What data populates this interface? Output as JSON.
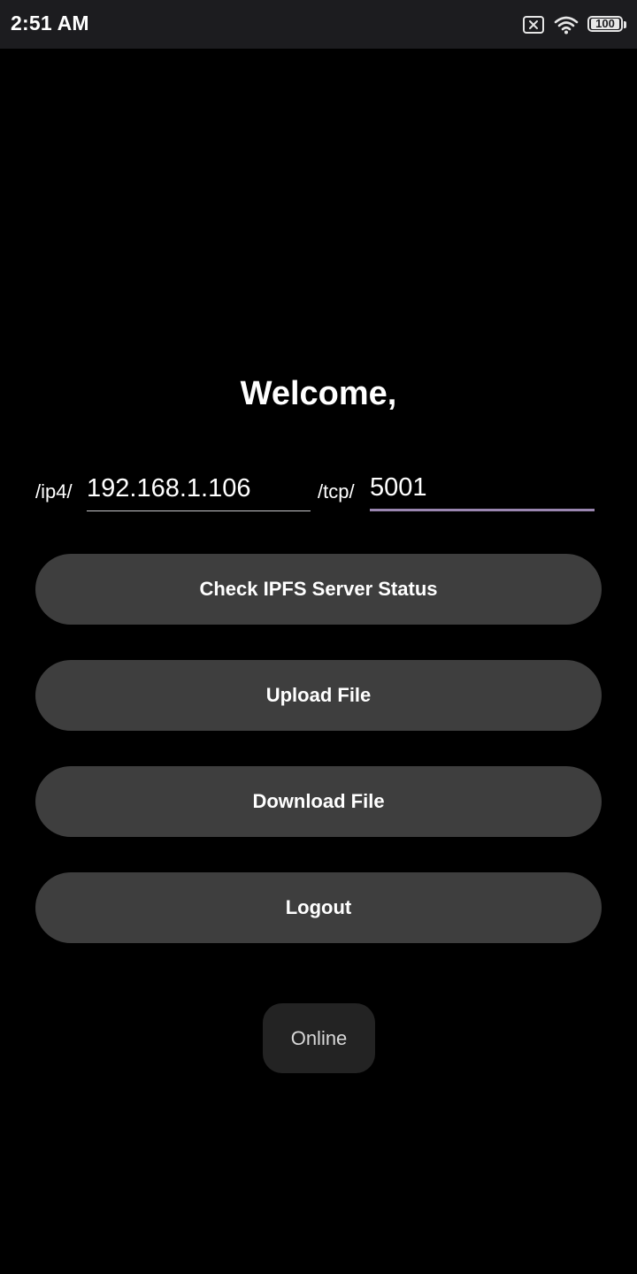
{
  "status_bar": {
    "time": "2:51 AM",
    "battery": "100",
    "icons": [
      "sim-missing-icon",
      "wifi-icon",
      "battery-icon"
    ]
  },
  "main": {
    "welcome": "Welcome,",
    "ip_prefix": "/ip4/",
    "ip_value": "192.168.1.106",
    "tcp_prefix": "/tcp/",
    "port_value": "5001"
  },
  "buttons": {
    "check_status": "Check IPFS Server Status",
    "upload": "Upload File",
    "download": "Download File",
    "logout": "Logout"
  },
  "toast": {
    "text": "Online"
  },
  "colors": {
    "background": "#000000",
    "button": "#3e3e3e",
    "focused_underline": "#9a86b0",
    "status_bar": "#1c1c1f"
  }
}
